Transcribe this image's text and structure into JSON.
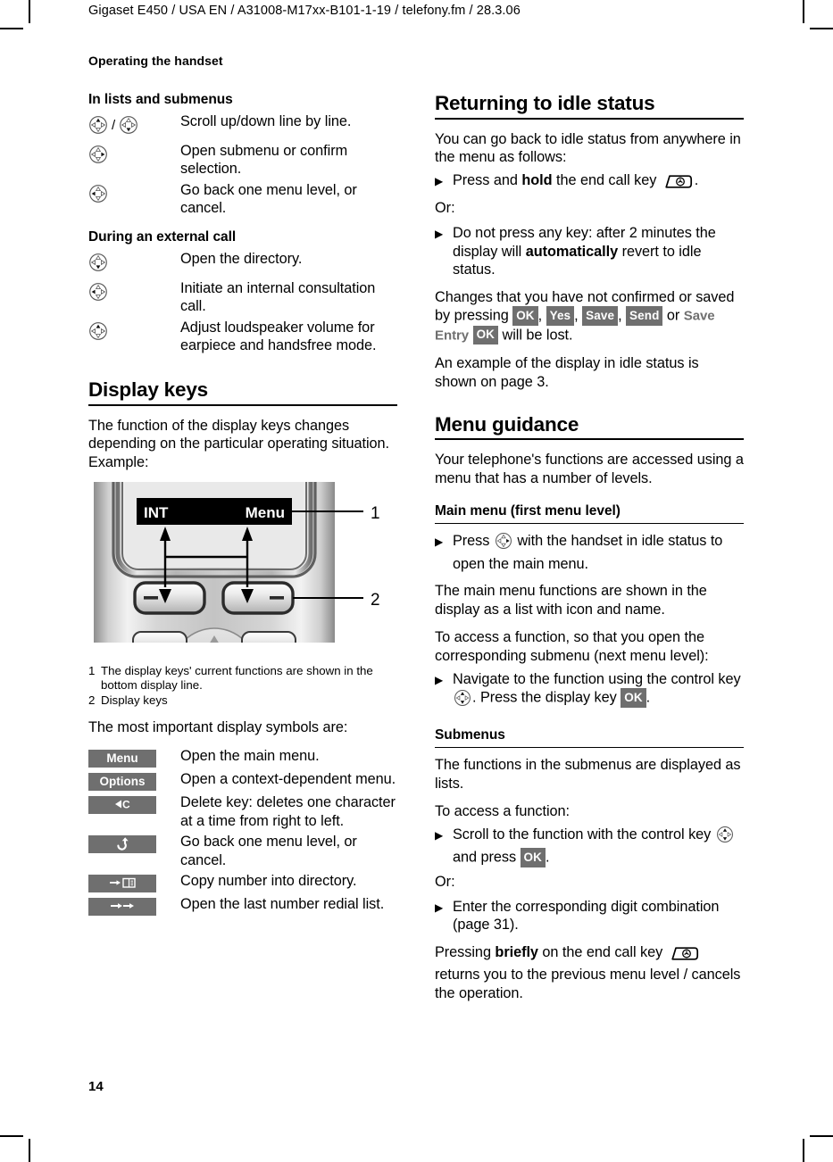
{
  "header": {
    "running_head": "Gigaset E450 / USA EN / A31008-M17xx-B101-1-19 / telefony.fm / 28.3.06",
    "chapter": "Operating the handset"
  },
  "footer": {
    "page_number": "14"
  },
  "left_column": {
    "section_lists": {
      "heading": "In lists and submenus",
      "rows": [
        {
          "icon": "control-key-up",
          "icon2": "control-key-down",
          "separator": "/",
          "text": "Scroll up/down line by line."
        },
        {
          "icon": "control-key-right",
          "text": "Open submenu or confirm selection."
        },
        {
          "icon": "control-key-left",
          "text": "Go back one menu level, or cancel."
        }
      ]
    },
    "section_external_call": {
      "heading": "During an external call",
      "rows": [
        {
          "icon": "control-key-down",
          "text": "Open the directory."
        },
        {
          "icon": "control-key-left",
          "text": "Initiate an internal consultation call."
        },
        {
          "icon": "control-key-up",
          "text": "Adjust loudspeaker volume for earpiece and handsfree mode."
        }
      ]
    },
    "section_display_keys": {
      "heading": "Display keys",
      "intro": "The function of the display keys changes depending on the particular operating situation. Example:",
      "figure": {
        "screen_left_label": "INT",
        "screen_right_label": "Menu",
        "callout_1": "1",
        "callout_2": "2",
        "caption_1_num": "1",
        "caption_1_text": "The display keys' current functions are shown in the bottom display line.",
        "caption_2_num": "2",
        "caption_2_text": "Display keys"
      },
      "symbols_intro": "The most important display symbols are:",
      "symbols": [
        {
          "badge": "Menu",
          "badge_kind": "text",
          "text": "Open the main menu."
        },
        {
          "badge": "Options",
          "badge_kind": "text",
          "text": "Open a context-dependent menu."
        },
        {
          "badge": "◀C",
          "badge_kind": "icon",
          "icon_name": "delete-key-icon",
          "text": "Delete key: deletes one character at a time from right to left."
        },
        {
          "badge": "↶",
          "badge_kind": "icon",
          "icon_name": "back-arrow-icon",
          "text": "Go back one menu level, or cancel."
        },
        {
          "badge": "→⌸",
          "badge_kind": "icon",
          "icon_name": "copy-to-directory-icon",
          "text": "Copy number into directory."
        },
        {
          "badge": "→→",
          "badge_kind": "icon",
          "icon_name": "redial-icon",
          "text": "Open the last number redial list."
        }
      ]
    }
  },
  "right_column": {
    "section_idle": {
      "heading": "Returning to idle status",
      "intro": "You can go back to idle status from anywhere in the menu as follows:",
      "bullet_1_pre": "Press and ",
      "bullet_1_bold": "hold",
      "bullet_1_mid": " the end call key ",
      "bullet_1_post": ".",
      "or_label": "Or:",
      "bullet_2_pre": "Do not press any key: after 2 minutes the display will ",
      "bullet_2_bold": "automatically",
      "bullet_2_post": " revert to idle status.",
      "changes_pre": "Changes that you have not confirmed or saved by pressing ",
      "badge_ok": "OK",
      "badge_yes": "Yes",
      "badge_save": "Save",
      "badge_send": "Send",
      "changes_or": " or ",
      "save_entry_label": "Save Entry",
      "badge_ok2": "OK",
      "changes_post": " will be lost.",
      "example_text": "An example of the display in idle status is shown on page 3."
    },
    "section_menu_guidance": {
      "heading": "Menu guidance",
      "intro": "Your telephone's functions are accessed using a menu that has a number of levels."
    },
    "section_main_menu": {
      "heading": "Main menu (first menu level)",
      "bullet_pre": "Press ",
      "bullet_post": " with the handset in idle status to open the main menu.",
      "para_1": "The main menu functions are shown in the display as a list with icon and name.",
      "para_2": "To access a function, so that you open the corresponding submenu (next menu level):",
      "bullet2_pre": "Navigate to the function using the control key ",
      "bullet2_mid": ". Press the display key ",
      "bullet2_badge": "OK",
      "bullet2_post": "."
    },
    "section_submenus": {
      "heading": "Submenus",
      "para_1": "The functions in the submenus are displayed as lists.",
      "para_2": "To access a function:",
      "bullet_pre": "Scroll to the function with the control key ",
      "bullet_mid": " and press ",
      "bullet_badge": "OK",
      "bullet_post": ".",
      "or_label": "Or:",
      "bullet2_text": "Enter the corresponding digit combination (page 31).",
      "closing_pre": "Pressing ",
      "closing_bold": "briefly",
      "closing_mid": " on the end call key ",
      "closing_post": "returns you to the previous menu level / cancels the operation."
    }
  },
  "colors": {
    "badge_gray": "#6f6f6f",
    "text_black": "#000000",
    "screen_black": "#000000",
    "screen_text": "#ffffff"
  }
}
